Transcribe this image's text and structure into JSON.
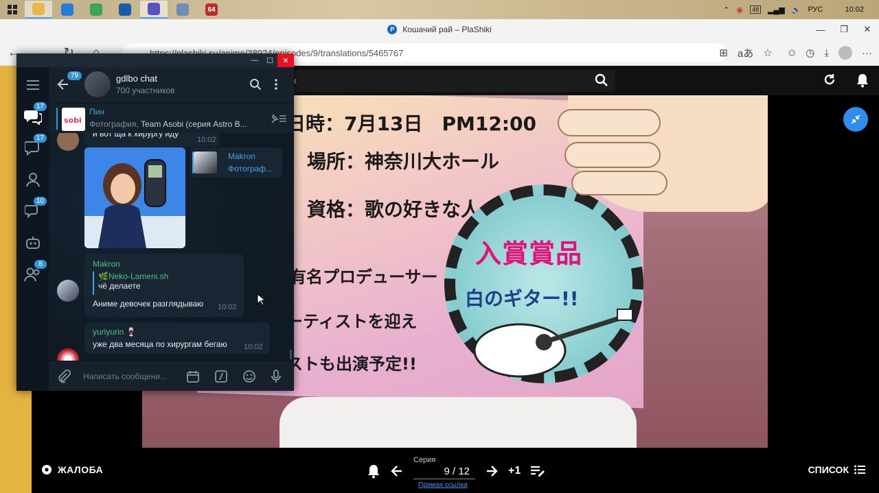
{
  "taskbar": {
    "apps": [
      {
        "name": "file-explorer",
        "color": "#e8b84a",
        "active": true
      },
      {
        "name": "edge",
        "color": "#1f7fd8",
        "active": false
      },
      {
        "name": "chrome",
        "color": "#3aa757",
        "active": false
      },
      {
        "name": "powershell",
        "color": "#1c5ba8",
        "active": false
      },
      {
        "name": "app-purple",
        "color": "#5a4fc4",
        "active": true
      },
      {
        "name": "remote",
        "color": "#6c8fb3",
        "active": false
      },
      {
        "name": "app-64",
        "color": "#c0282d",
        "active": false,
        "label": "64"
      }
    ],
    "tray": {
      "badge": "48",
      "lang": "РУС",
      "time": "10:02"
    }
  },
  "browser": {
    "title": "Кошачий рай – PlaShiki",
    "url": "https://plashiki.su/anime/38924/episodes/9/translations/5465767"
  },
  "site": {
    "search_query": "к"
  },
  "poster": {
    "lines": [
      "日時：7月13日　PM12:00",
      "場所：神奈川大ホール",
      "資格：歌の好きな人",
      "有名プロデューサー",
      "ーティストを迎え",
      "ストも出演予定!!"
    ],
    "prize_title": "入賞賞品",
    "prize_sub": "白のギター!!"
  },
  "player": {
    "complain_label": "ЖАЛОБА",
    "episode_label": "Серия",
    "episode_value": "9 / 12",
    "plus_one": "+1",
    "direct_link": "Прямая ссылка",
    "list_label": "СПИСОК"
  },
  "telegram": {
    "sidebar_badges": [
      "17",
      "17",
      "10",
      "8"
    ],
    "back_badge": "79",
    "chat_name": "gdlbo chat",
    "chat_sub": "700 участников",
    "pin": {
      "title": "Пин",
      "prefix": "Фотография, ",
      "text": "Team Asobi (серия Astro B..."
    },
    "messages": [
      {
        "text": "и вот ща к хирургу иду",
        "time": "10:02"
      },
      {
        "reply_name": "Makron",
        "reply_text": "Фотограф..."
      },
      {
        "name": "Makron",
        "name_color": "#4fc27c",
        "reply_name": "🌿Neko-Lameni.sh",
        "reply_text": "чё делаете",
        "text": "Аниме девочек разглядываю",
        "time": "10:02"
      },
      {
        "name": "yuriyurin 🍷",
        "name_color": "#4fc27c",
        "text": "уже два месяца по хирургам бегаю",
        "time": "10:02"
      }
    ],
    "input_placeholder": "Написать сообщени..."
  }
}
